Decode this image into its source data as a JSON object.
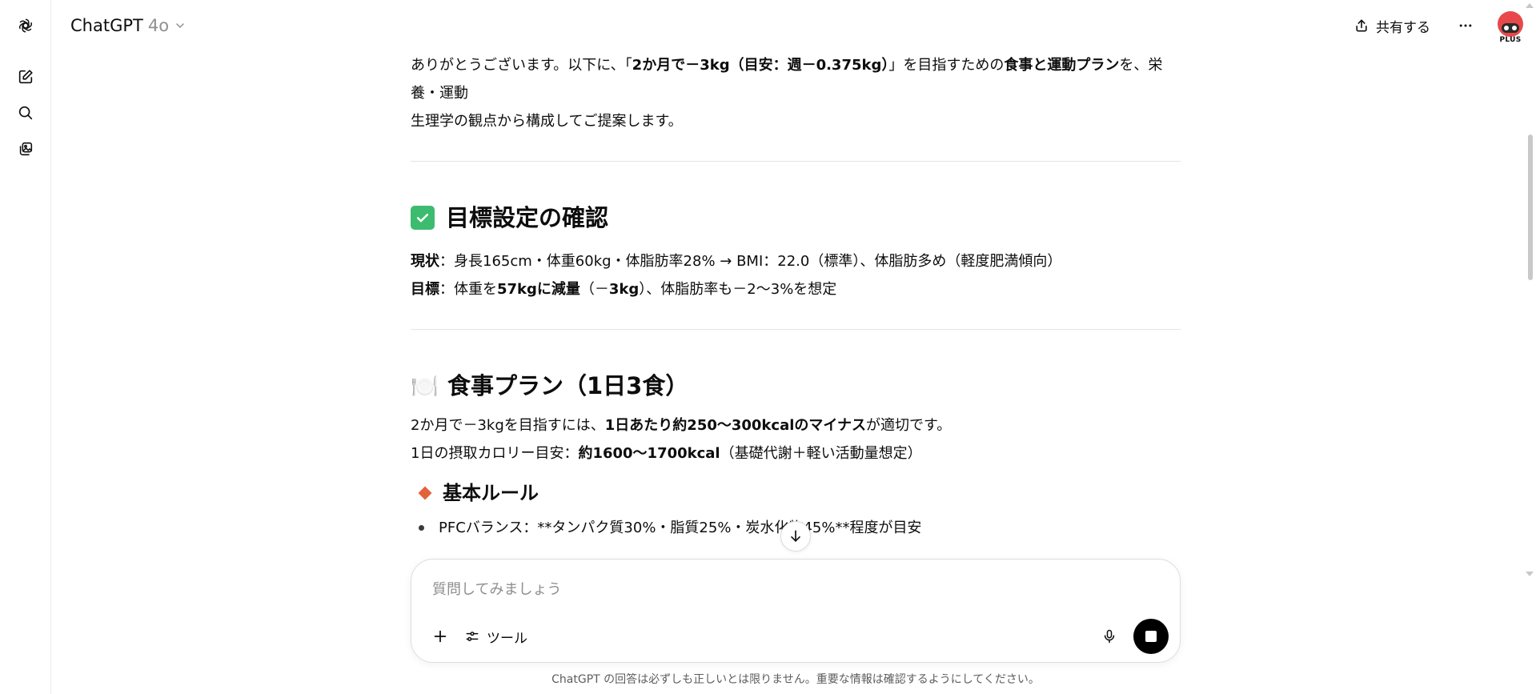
{
  "header": {
    "app_name": "ChatGPT",
    "model_version": "4o",
    "share_label": "共有する",
    "plan_badge": "PLUS"
  },
  "message": {
    "intro_line1_pre": "ありがとうございます。以下に、「",
    "intro_line1_bold": "2か月で－3kg（目安：週－0.375kg）",
    "intro_line1_mid": "」を目指すための",
    "intro_line1_bold2": "食事と運動プラン",
    "intro_line1_post": "を、栄養・運動",
    "intro_line2": "生理学の観点から構成してご提案します。",
    "section1": {
      "title": "目標設定の確認",
      "current_label": "現状",
      "current_text": "：身長165cm・体重60kg・体脂肪率28% → BMI：22.0（標準）、体脂肪多め（軽度肥満傾向）",
      "goal_label": "目標",
      "goal_text_pre": "：体重を",
      "goal_text_bold": "57kgに減量",
      "goal_text_post": "（－",
      "goal_text_bold2": "3kg",
      "goal_text_end": "）、体脂肪率も－2〜3%を想定"
    },
    "section2": {
      "emoji": "🍽️",
      "title": "食事プラン（1日3食）",
      "line1_pre": "2か月で－3kgを目指すには、",
      "line1_bold": "1日あたり約250〜300kcalのマイナス",
      "line1_post": "が適切です。",
      "line2_pre": "1日の摂取カロリー目安：",
      "line2_bold": "約1600〜1700kcal",
      "line2_post": "（基礎代謝＋軽い活動量想定）",
      "subsection": {
        "title": "基本ルール",
        "bullet1": "PFCバランス：**タンパク質30%・脂質25%・炭水化物45%**程度が目安"
      }
    }
  },
  "composer": {
    "placeholder": "質問してみましょう",
    "tools_label": "ツール"
  },
  "footer": {
    "disclaimer": "ChatGPT の回答は必ずしも正しいとは限りません。重要な情報は確認するようにしてください。"
  },
  "colors": {
    "check_green": "#3dbb6f",
    "diamond_orange": "#e2633a",
    "stop_black": "#000000"
  }
}
